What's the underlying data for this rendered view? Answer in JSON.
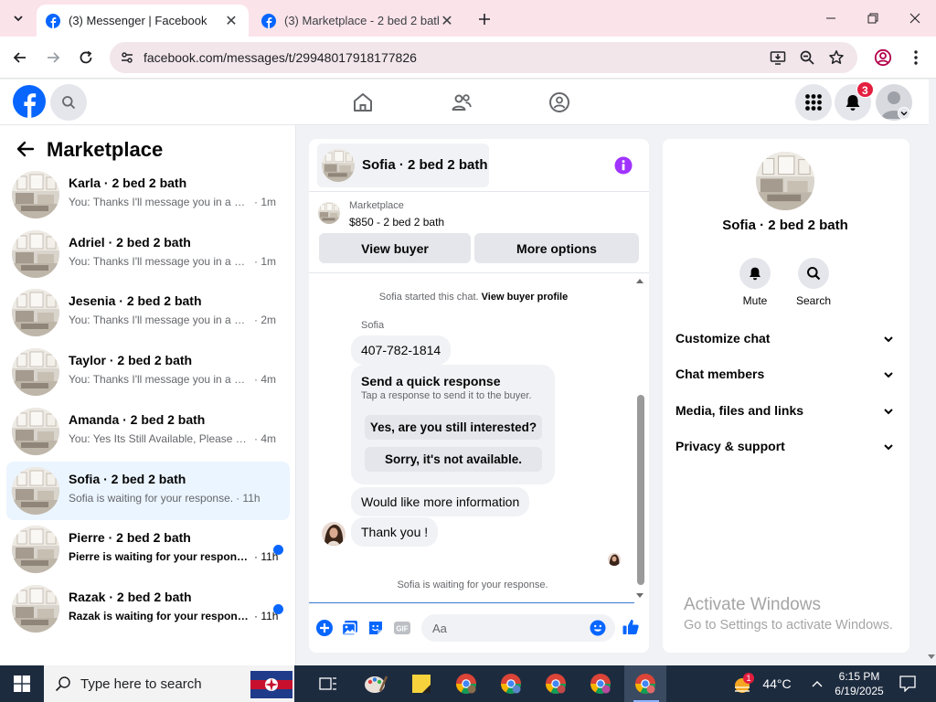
{
  "browser": {
    "tabs": [
      {
        "title": "(3) Messenger | Facebook",
        "active": true
      },
      {
        "title": "(3) Marketplace - 2 bed 2 bath",
        "active": false
      }
    ],
    "url": "facebook.com/messages/t/29948017918177826"
  },
  "header": {
    "notification_count": "3"
  },
  "sidebar": {
    "title": "Marketplace",
    "conversations": [
      {
        "name": "Karla · 2 bed 2 bath",
        "snippet": "You: Thanks I'll message you in a mo...",
        "time": "· 1m",
        "unread": false,
        "selected": false
      },
      {
        "name": "Adriel · 2 bed 2 bath",
        "snippet": "You: Thanks I'll message you in a mo...",
        "time": "· 1m",
        "unread": false,
        "selected": false
      },
      {
        "name": "Jesenia · 2 bed 2 bath",
        "snippet": "You: Thanks I'll message you in a mo...",
        "time": "· 2m",
        "unread": false,
        "selected": false
      },
      {
        "name": "Taylor · 2 bed 2 bath",
        "snippet": "You: Thanks I'll message you in a mo...",
        "time": "· 4m",
        "unread": false,
        "selected": false
      },
      {
        "name": "Amanda · 2 bed 2 bath",
        "snippet": "You: Yes Its Still Available, Please Sen...",
        "time": "· 4m",
        "unread": false,
        "selected": false
      },
      {
        "name": "Sofia · 2 bed 2 bath",
        "snippet": "Sofia is waiting for your response.",
        "time": "· 11h",
        "unread": false,
        "selected": true
      },
      {
        "name": "Pierre · 2 bed 2 bath",
        "snippet": "Pierre is waiting for your response.",
        "time": "· 11h",
        "unread": true,
        "selected": false
      },
      {
        "name": "Razak · 2 bed 2 bath",
        "snippet": "Razak is waiting for your response.",
        "time": "· 11h",
        "unread": true,
        "selected": false
      }
    ]
  },
  "chat": {
    "title": "Sofia · 2 bed 2 bath",
    "listing_label": "Marketplace",
    "listing_price": "$850 - 2 bed 2 bath",
    "view_buyer_label": "View buyer",
    "more_options_label": "More options",
    "started_text": "Sofia started this chat.",
    "view_profile_link": "View buyer profile",
    "sender_name": "Sofia",
    "messages": [
      "407-782-1814",
      "Would like more information",
      "Thank you !"
    ],
    "quick_title": "Send a quick response",
    "quick_subtitle": "Tap a response to send it to the buyer.",
    "quick_options": [
      "Yes, are you still interested?",
      "Sorry, it's not available."
    ],
    "waiting_text": "Sofia is waiting for your response.",
    "input_placeholder": "Aa"
  },
  "info_panel": {
    "name": "Sofia · 2 bed 2 bath",
    "actions": [
      "Mute",
      "Search"
    ],
    "sections": [
      "Customize chat",
      "Chat members",
      "Media, files and links",
      "Privacy & support"
    ]
  },
  "watermark": {
    "line1": "Activate Windows",
    "line2": "Go to Settings to activate Windows."
  },
  "taskbar": {
    "search_placeholder": "Type here to search",
    "weather_badge": "1",
    "temperature": "44°C",
    "time": "6:15 PM",
    "date": "6/19/2025"
  },
  "colors": {
    "facebook_blue": "#0866ff",
    "info_purple": "#a033ff",
    "selected_row": "#ebf5ff",
    "badge_red": "#e41e3f"
  }
}
